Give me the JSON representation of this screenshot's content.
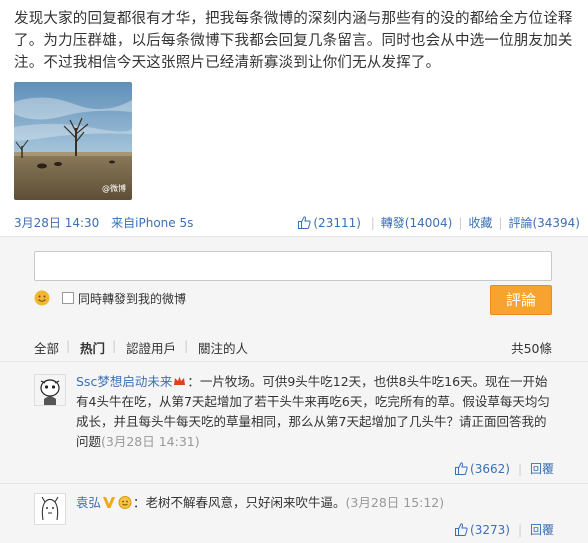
{
  "post": {
    "text": "发现大家的回复都很有才华，把我每条微博的深刻内涵与那些有的没的都给全方位诠释了。为力压群雄，以后每条微博下我都会回复几条留言。同时也会从中选一位朋友加关注。不过我相信今天这张照片已经清新寡淡到让你们无从发挥了。",
    "photo_watermark": "@微博",
    "time": "3月28日 14:30",
    "source": "来自iPhone 5s"
  },
  "post_actions": {
    "like_count": "(23111)",
    "repost": "轉發(14004)",
    "favorite": "收藏",
    "comment": "評論(34394)"
  },
  "comment_form": {
    "input_placeholder": "",
    "repost_label": "同時轉發到我的微博",
    "submit_label": "評論"
  },
  "filter": {
    "all": "全部",
    "hot": "热门",
    "verified": "認證用戶",
    "following": "關注的人",
    "count": "共50條"
  },
  "comments": [
    {
      "username": "Ssc梦想启动未来",
      "text": "：一片牧场。可供9头牛吃12天，也供8头牛吃16天。现在一开始有4头牛在吃，从第7天起增加了若干头牛来再吃6天，吃完所有的草。假设草每天均匀成长，并且每头牛每天吃的草量相同，那么从第7天起增加了几头牛？请正面回答我的问题",
      "time": "(3月28日 14:31)",
      "likes": "(3662)",
      "reply": "回覆"
    },
    {
      "username": "袁弘",
      "text": "：老树不解春风意，只好闲来吹牛逼。",
      "time": "(3月28日 15:12)",
      "likes": "(3273)",
      "reply": "回覆"
    }
  ],
  "colors": {
    "link": "#3b6fb6",
    "submit": "#f7a32f",
    "panel": "#f5f5f5"
  }
}
